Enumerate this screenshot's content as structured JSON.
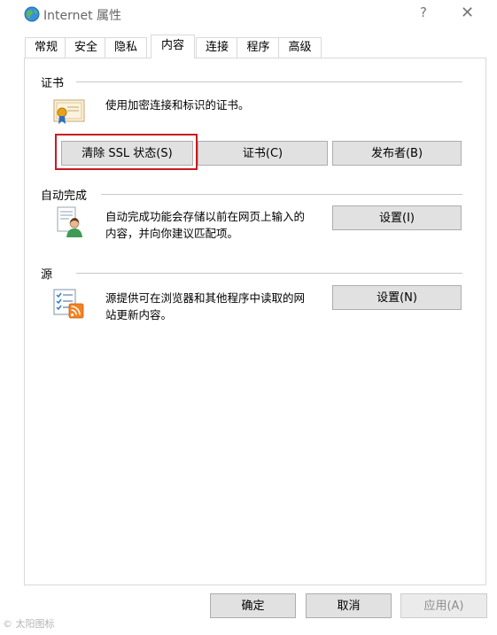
{
  "window": {
    "title": "Internet 属性",
    "help_glyph": "?",
    "close_glyph": "✕"
  },
  "tabs": [
    {
      "label": "常规",
      "active": false
    },
    {
      "label": "安全",
      "active": false
    },
    {
      "label": "隐私",
      "active": false
    },
    {
      "label": "内容",
      "active": true
    },
    {
      "label": "连接",
      "active": false
    },
    {
      "label": "程序",
      "active": false
    },
    {
      "label": "高级",
      "active": false
    }
  ],
  "certificates": {
    "group_label": "证书",
    "description": "使用加密连接和标识的证书。",
    "icon": "certificate-icon",
    "buttons": {
      "clear_ssl": "清除 SSL 状态(S)",
      "certificates": "证书(C)",
      "publishers": "发布者(B)"
    },
    "highlight_color": "#c9191f"
  },
  "autocomplete": {
    "group_label": "自动完成",
    "description_line1": "自动完成功能会存储以前在网页上输入的",
    "description_line2": "内容，并向你建议匹配项。",
    "icon": "autocomplete-icon",
    "settings_button": "设置(I)"
  },
  "feeds": {
    "group_label": "源",
    "description_line1": "源提供可在浏览器和其他程序中读取的网",
    "description_line2": "站更新内容。",
    "icon": "feed-icon",
    "settings_button": "设置(N)"
  },
  "footer": {
    "ok": "确定",
    "cancel": "取消",
    "apply": "应用(A)"
  },
  "watermark": "© 太阳图标"
}
